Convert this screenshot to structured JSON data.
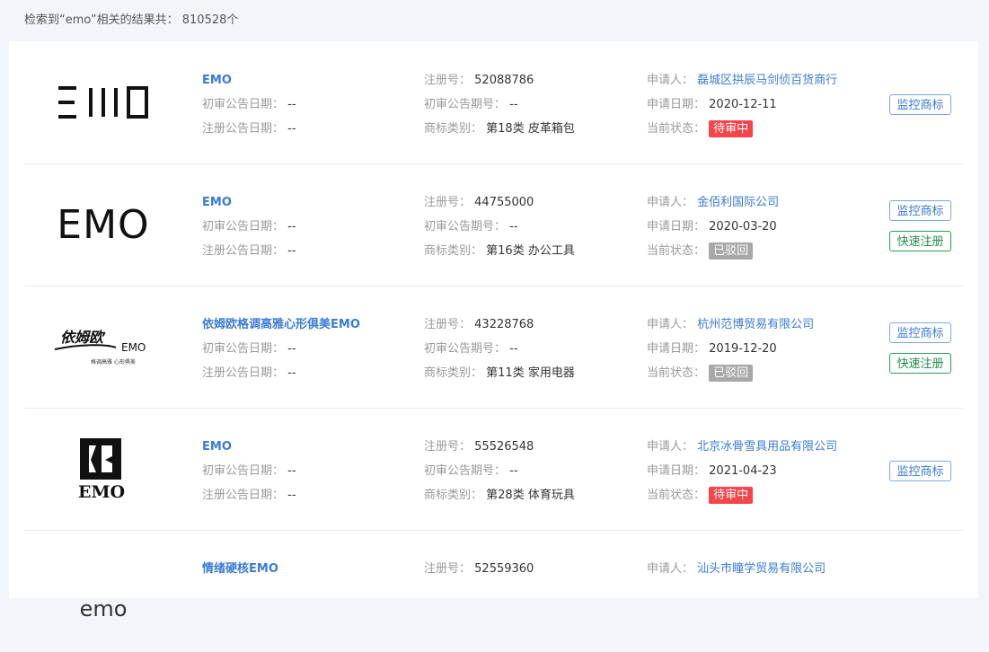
{
  "summary": "检索到“emo”相关的结果共： 810528个",
  "labels": {
    "first_notice_date": "初审公告日期：",
    "reg_notice_date": "注册公告日期：",
    "reg_no": "注册号：",
    "first_notice_no": "初审公告期号：",
    "category": "商标类别：",
    "applicant": "申请人：",
    "apply_date": "申请日期：",
    "status": "当前状态：",
    "monitor_button": "监控商标",
    "quick_register_button": "快速注册"
  },
  "colors": {
    "accent": "#3a7bd5",
    "pending": "#f5454a",
    "rejected": "#a8a8a8",
    "register": "#2e9e58"
  },
  "results": [
    {
      "name": "EMO",
      "logo_text": "EMO",
      "first_notice_date": "--",
      "reg_notice_date": "--",
      "reg_no": "52088786",
      "first_notice_no": "--",
      "category": "第18类 皮革箱包",
      "applicant": "磊城区拱辰马剑侦百货商行",
      "apply_date": "2020-12-11",
      "status": "待审中"
    },
    {
      "name": "EMO",
      "logo_text": "EMO",
      "first_notice_date": "--",
      "reg_notice_date": "--",
      "reg_no": "44755000",
      "first_notice_no": "--",
      "category": "第16类 办公工具",
      "applicant": "金佰利国际公司",
      "apply_date": "2020-03-20",
      "status": "已驳回"
    },
    {
      "name": "依姆欧格调高雅心形俱美EMO",
      "logo_text_cn": "依姆欧",
      "logo_text_en": "EMO",
      "logo_slogan": "格调高雅 心形俱美",
      "first_notice_date": "--",
      "reg_notice_date": "--",
      "reg_no": "43228768",
      "first_notice_no": "--",
      "category": "第11类 家用电器",
      "applicant": "杭州范博贸易有限公司",
      "apply_date": "2019-12-20",
      "status": "已驳回"
    },
    {
      "name": "EMO",
      "logo_text": "EMO",
      "first_notice_date": "--",
      "reg_notice_date": "--",
      "reg_no": "55526548",
      "first_notice_no": "--",
      "category": "第28类 体育玩具",
      "applicant": "北京冰骨雪具用品有限公司",
      "apply_date": "2021-04-23",
      "status": "待审中"
    },
    {
      "name": "情绪硬核EMO",
      "logo_text": "emo",
      "reg_no": "52559360",
      "applicant": "汕头市瞳学贸易有限公司"
    }
  ]
}
